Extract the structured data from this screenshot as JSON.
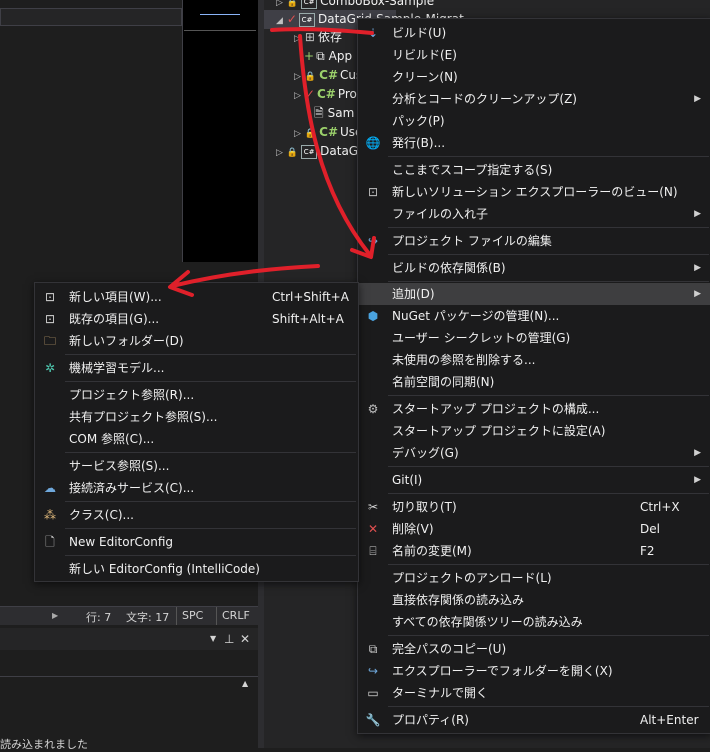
{
  "statusbar": {
    "line": "行: 7",
    "col": "文字: 17",
    "spc": "SPC",
    "crlf": "CRLF"
  },
  "bottom_panel": {
    "output_text": "読み込まれました"
  },
  "tree": [
    {
      "label": "ComboBox-Sample"
    },
    {
      "label": "DataGrid-Sample-Migrat"
    },
    {
      "label": "依存"
    },
    {
      "label": "App"
    },
    {
      "label": "Cust"
    },
    {
      "label": "Prog"
    },
    {
      "label": "Sam"
    },
    {
      "label": "Use"
    },
    {
      "label": "DataGri"
    }
  ],
  "context_menu": [
    {
      "label": "ビルド(U)"
    },
    {
      "label": "リビルド(E)"
    },
    {
      "label": "クリーン(N)"
    },
    {
      "label": "分析とコードのクリーンアップ(Z)"
    },
    {
      "label": "パック(P)"
    },
    {
      "label": "発行(B)..."
    },
    {
      "label": "ここまでスコープ指定する(S)"
    },
    {
      "label": "新しいソリューション エクスプローラーのビュー(N)"
    },
    {
      "label": "ファイルの入れ子"
    },
    {
      "label": "プロジェクト ファイルの編集"
    },
    {
      "label": "ビルドの依存関係(B)"
    },
    {
      "label": "追加(D)"
    },
    {
      "label": "NuGet パッケージの管理(N)..."
    },
    {
      "label": "ユーザー シークレットの管理(G)"
    },
    {
      "label": "未使用の参照を削除する..."
    },
    {
      "label": "名前空間の同期(N)"
    },
    {
      "label": "スタートアップ プロジェクトの構成..."
    },
    {
      "label": "スタートアップ プロジェクトに設定(A)"
    },
    {
      "label": "デバッグ(G)"
    },
    {
      "label": "Git(I)"
    },
    {
      "label": "切り取り(T)",
      "shortcut": "Ctrl+X"
    },
    {
      "label": "削除(V)",
      "shortcut": "Del"
    },
    {
      "label": "名前の変更(M)",
      "shortcut": "F2"
    },
    {
      "label": "プロジェクトのアンロード(L)"
    },
    {
      "label": "直接依存関係の読み込み"
    },
    {
      "label": "すべての依存関係ツリーの読み込み"
    },
    {
      "label": "完全パスのコピー(U)"
    },
    {
      "label": "エクスプローラーでフォルダーを開く(X)"
    },
    {
      "label": "ターミナルで開く"
    },
    {
      "label": "プロパティ(R)",
      "shortcut": "Alt+Enter"
    }
  ],
  "submenu": [
    {
      "label": "新しい項目(W)...",
      "shortcut": "Ctrl+Shift+A"
    },
    {
      "label": "既存の項目(G)...",
      "shortcut": "Shift+Alt+A"
    },
    {
      "label": "新しいフォルダー(D)"
    },
    {
      "label": "機械学習モデル..."
    },
    {
      "label": "プロジェクト参照(R)..."
    },
    {
      "label": "共有プロジェクト参照(S)..."
    },
    {
      "label": "COM 参照(C)..."
    },
    {
      "label": "サービス参照(S)..."
    },
    {
      "label": "接続済みサービス(C)..."
    },
    {
      "label": "クラス(C)..."
    },
    {
      "label": "New EditorConfig"
    },
    {
      "label": "新しい EditorConfig (IntelliCode)"
    }
  ],
  "colors": {
    "annotation": "#e0202a",
    "highlight": "#3e3e40",
    "menu_bg": "#1b1b1c"
  }
}
